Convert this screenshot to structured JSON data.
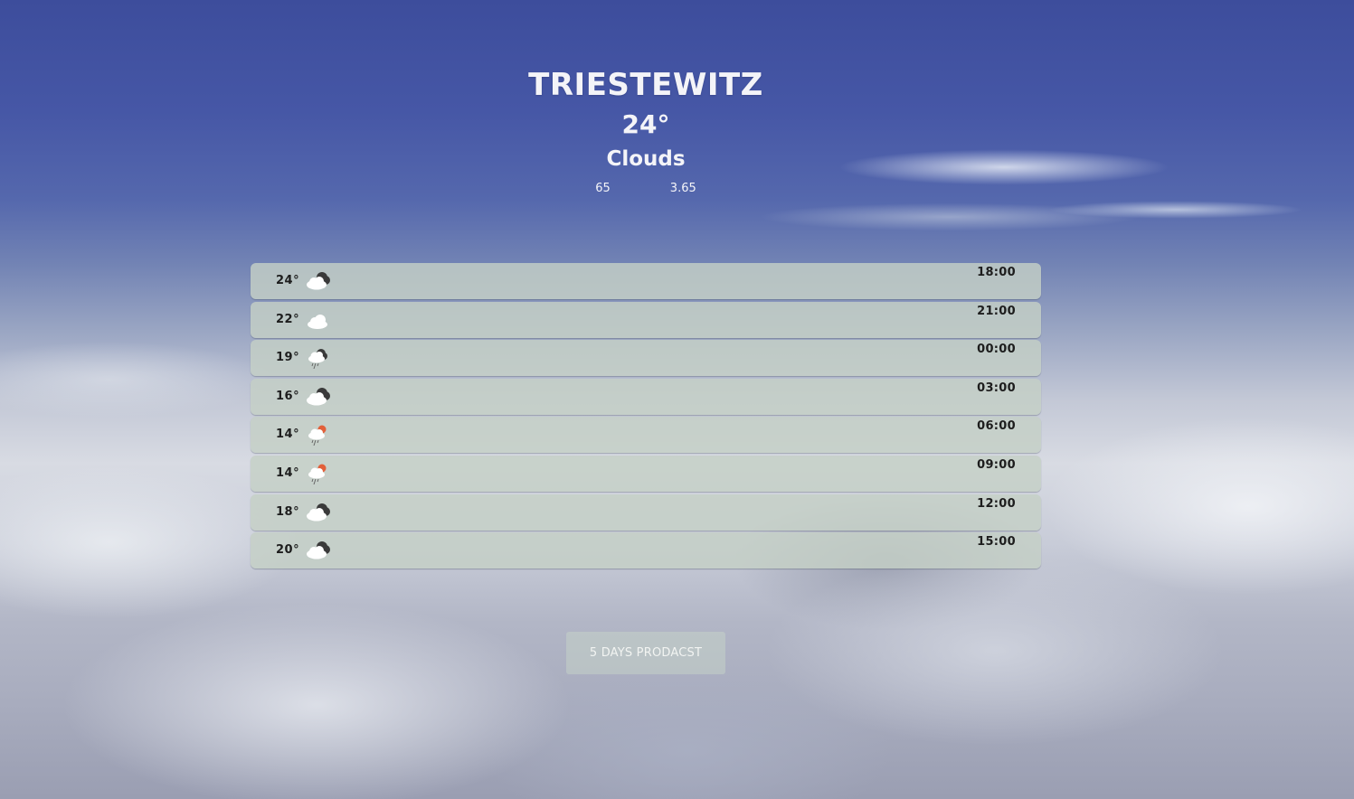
{
  "location": {
    "city": "TRIESTEWITZ",
    "temperature": "24°",
    "description": "Clouds",
    "details": [
      "65",
      "3.65"
    ]
  },
  "forecast": [
    {
      "temp": "24°",
      "icon": "cloud-dark-icon",
      "time": "18:00"
    },
    {
      "temp": "22°",
      "icon": "cloud-icon",
      "time": "21:00"
    },
    {
      "temp": "19°",
      "icon": "rain-cloud-icon",
      "time": "00:00"
    },
    {
      "temp": "16°",
      "icon": "cloud-dark-icon",
      "time": "03:00"
    },
    {
      "temp": "14°",
      "icon": "sun-rain-cloud-icon",
      "time": "06:00"
    },
    {
      "temp": "14°",
      "icon": "sun-rain-cloud-icon",
      "time": "09:00"
    },
    {
      "temp": "18°",
      "icon": "cloud-dark-icon",
      "time": "12:00"
    },
    {
      "temp": "20°",
      "icon": "cloud-dark-icon",
      "time": "15:00"
    }
  ],
  "button": {
    "label": "5 DAYS PRODACST"
  }
}
